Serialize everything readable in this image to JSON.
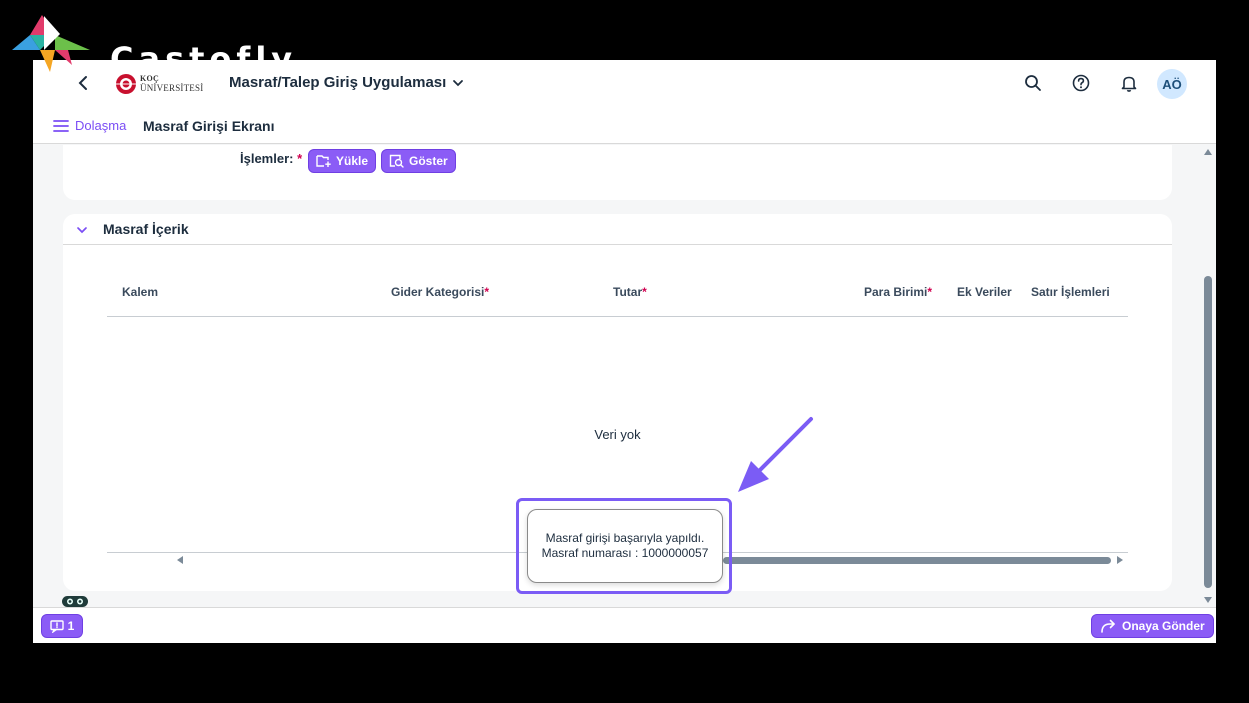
{
  "brand": {
    "name": "Castofly"
  },
  "shell": {
    "logo_top": "KOÇ",
    "logo_bottom": "ÜNİVERSİTESİ",
    "app_title": "Masraf/Talep Giriş Uygulaması",
    "avatar_initials": "AÖ"
  },
  "subheader": {
    "nav_label": "Dolaşma",
    "page_title": "Masraf Girişi Ekranı"
  },
  "operations": {
    "label": "İşlemler:",
    "required_mark": "*",
    "upload_label": "Yükle",
    "show_label": "Göster"
  },
  "panel": {
    "title": "Masraf İçerik",
    "columns": [
      {
        "label": "Kalem",
        "required": false
      },
      {
        "label": "Gider Kategorisi",
        "required": true
      },
      {
        "label": "Tutar",
        "required": true
      },
      {
        "label": "Para Birimi",
        "required": true
      },
      {
        "label": "Ek Veriler",
        "required": false
      },
      {
        "label": "Satır İşlemleri",
        "required": false
      }
    ],
    "empty_text": "Veri yok"
  },
  "toast": {
    "message": "Masraf girişi başarıyla yapıldı. Masraf numarası : 1000000057"
  },
  "footer": {
    "message_count": "1",
    "send_label": "Onaya Gönder"
  },
  "colors": {
    "accent": "#8b5cf6",
    "highlight_frame": "#7b5cf5",
    "required": "#d0004f"
  }
}
